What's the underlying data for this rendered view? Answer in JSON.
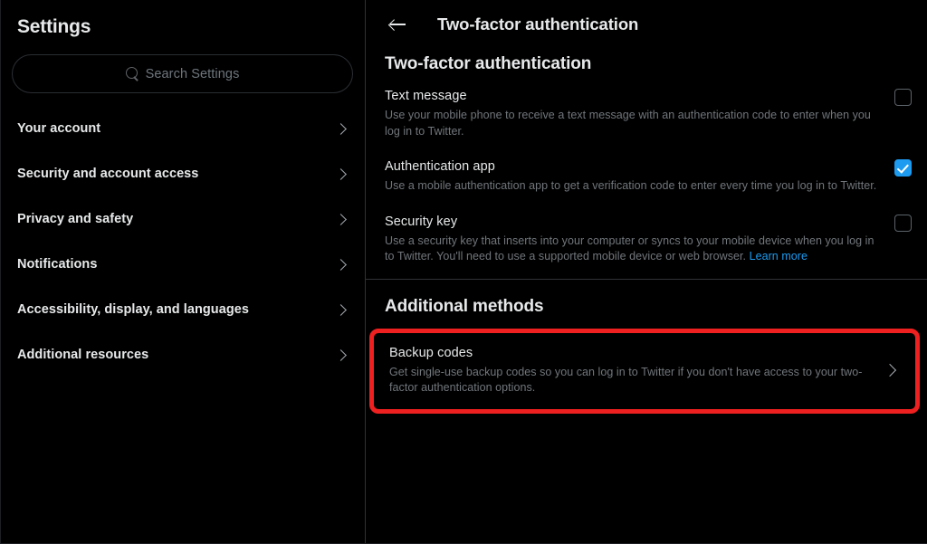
{
  "sidebar": {
    "title": "Settings",
    "search": {
      "placeholder": "Search Settings",
      "value": "",
      "icon": "search-icon"
    },
    "items": [
      {
        "label": "Your account",
        "chevron": "chevron-right-icon"
      },
      {
        "label": "Security and account access",
        "chevron": "chevron-right-icon"
      },
      {
        "label": "Privacy and safety",
        "chevron": "chevron-right-icon"
      },
      {
        "label": "Notifications",
        "chevron": "chevron-right-icon"
      },
      {
        "label": "Accessibility, display, and languages",
        "chevron": "chevron-right-icon"
      },
      {
        "label": "Additional resources",
        "chevron": "chevron-right-icon"
      }
    ]
  },
  "main": {
    "header": {
      "back_icon": "arrow-left-icon",
      "title": "Two-factor authentication"
    },
    "section_title": "Two-factor authentication",
    "options": [
      {
        "label": "Text message",
        "description": "Use your mobile phone to receive a text message with an authentication code to enter when you log in to Twitter.",
        "checked": false
      },
      {
        "label": "Authentication app",
        "description": "Use a mobile authentication app to get a verification code to enter every time you log in to Twitter.",
        "checked": true
      },
      {
        "label": "Security key",
        "description": "Use a security key that inserts into your computer or syncs to your mobile device when you log in to Twitter. You'll need to use a supported mobile device or web browser. ",
        "link_text": "Learn more",
        "checked": false
      }
    ],
    "additional_methods": {
      "title": "Additional methods",
      "backup_codes": {
        "label": "Backup codes",
        "description": "Get single-use backup codes so you can log in to Twitter if you don't have access to your two-factor authentication options.",
        "chevron": "chevron-right-icon",
        "highlight_color": "#ef2020"
      }
    }
  },
  "colors": {
    "background": "#000000",
    "text_primary": "#e7e9ea",
    "text_secondary": "#71767b",
    "accent": "#1d9bf0",
    "divider": "#2f3336",
    "highlight": "#ef2020"
  }
}
